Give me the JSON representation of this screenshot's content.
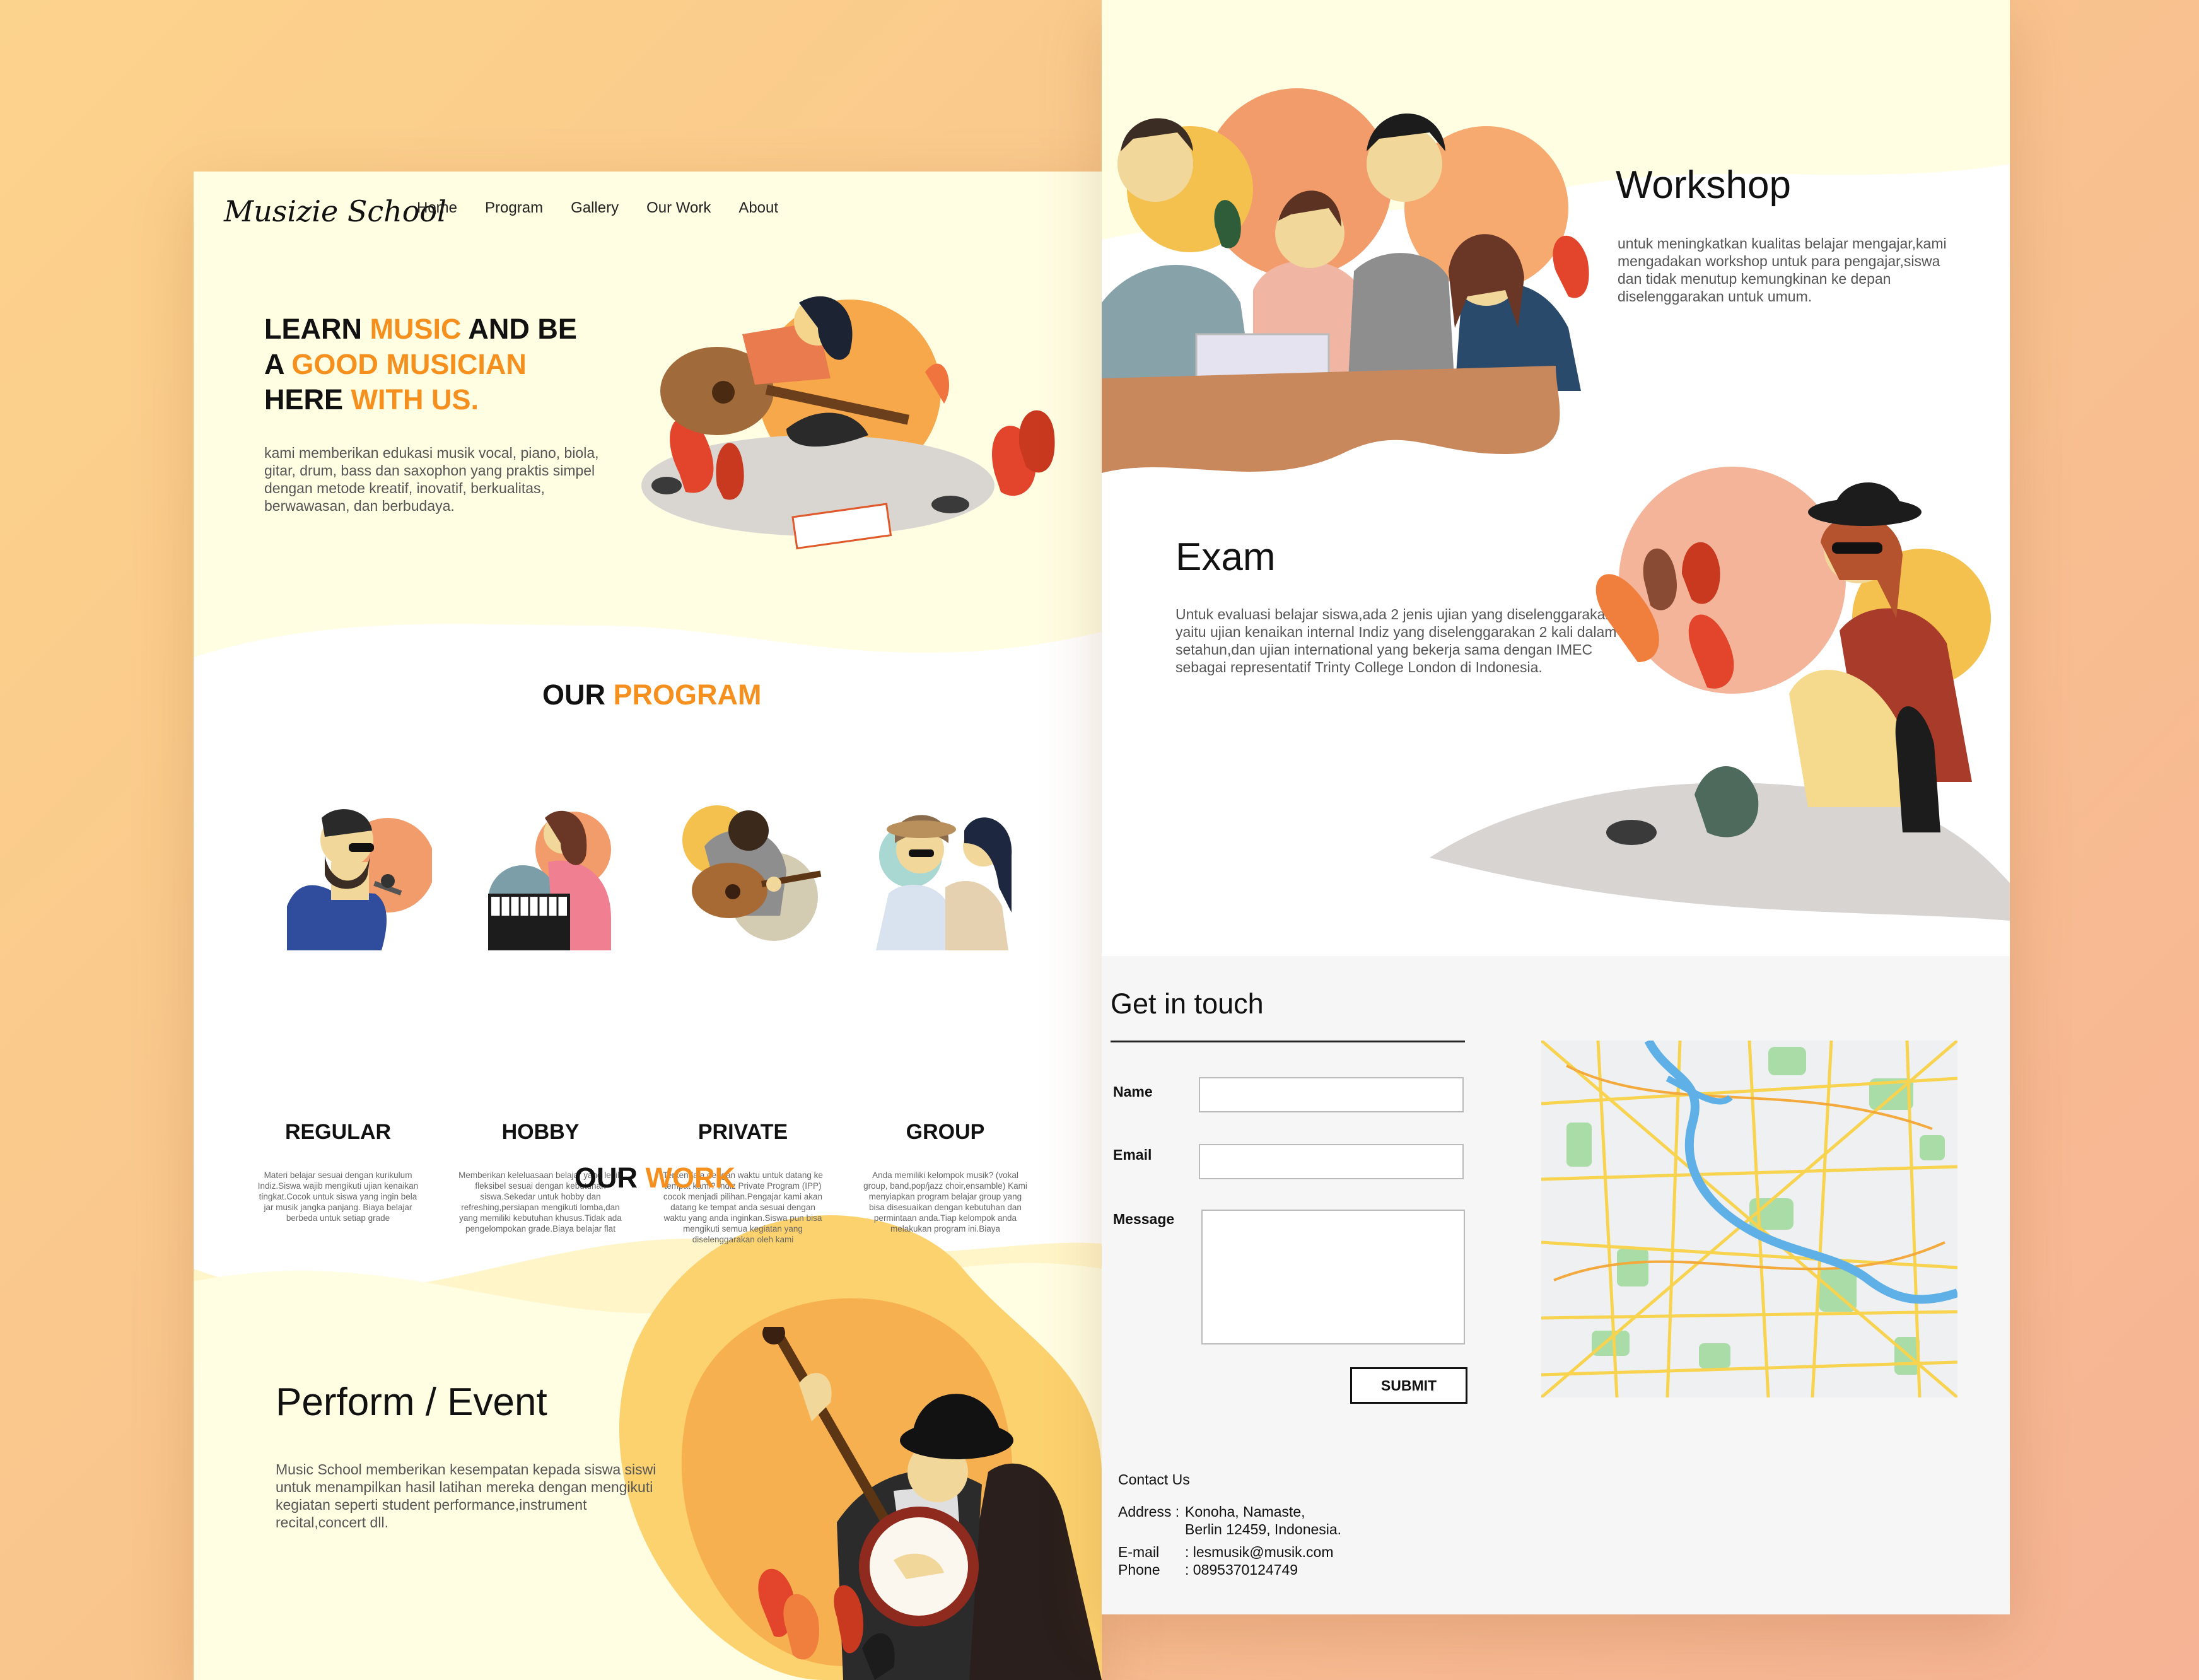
{
  "brand": {
    "logo": "Musizie School"
  },
  "nav": {
    "items": [
      "Home",
      "Program",
      "Gallery",
      "Our Work",
      "About"
    ]
  },
  "hero": {
    "line1_a": "LEARN ",
    "line1_b": "MUSIC",
    "line1_c": " AND BE",
    "line2_a": "A ",
    "line2_b": "GOOD MUSICIAN",
    "line3_a": "HERE ",
    "line3_b": "WITH US.",
    "description": "kami memberikan edukasi musik vocal, piano, biola, gitar, drum, bass dan saxophon yang praktis simpel dengan metode kreatif, inovatif, berkualitas, berwawasan, dan berbudaya."
  },
  "program": {
    "title_a": "OUR ",
    "title_b": "PROGRAM",
    "items": [
      {
        "label": "REGULAR",
        "desc": "Materi belajar sesuai dengan kurikulum Indiz.Siswa wajib mengikuti ujian kenaikan tingkat.Cocok untuk siswa yang ingin bela jar musik jangka panjang. Biaya belajar berbeda untuk setiap grade"
      },
      {
        "label": "HOBBY",
        "desc": "Memberikan keleluasaan belajar yang lebih fleksibel sesuai dengan kebutuhan siswa.Sekedar untuk hobby dan refreshing,persiapan mengikuti lomba,dan yang memiliki kebutuhan khusus.Tidak ada pengelompokan grade.Biaya belajar flat"
      },
      {
        "label": "PRIVATE",
        "desc": "Terkendala dengan waktu untuk datang ke tempat kami? Indiz Private Program (IPP) cocok menjadi pilihan.Pengajar kami akan datang ke tempat anda sesuai dengan waktu yang anda inginkan.Siswa pun bisa mengikuti semua kegiatan yang diselenggarakan oleh kami"
      },
      {
        "label": "GROUP",
        "desc": "Anda memiliki kelompok musik? (vokal group, band,pop/jazz choir,ensamble) Kami menyiapkan program belajar group yang bisa disesuaikan dengan kebutuhan dan permintaan anda.Tiap kelompok anda melakukan program ini.Biaya"
      }
    ]
  },
  "work": {
    "title_a": "OUR ",
    "title_b": "WORK",
    "perform": {
      "title": "Perform / Event",
      "desc": "Music School memberikan kesempatan kepada siswa siswi untuk menampilkan hasil latihan mereka dengan mengikuti kegiatan seperti student performance,instrument recital,concert dll."
    },
    "workshop": {
      "title": "Workshop",
      "desc": "untuk meningkatkan kualitas belajar mengajar,kami mengadakan workshop untuk para pengajar,siswa dan tidak menutup kemungkinan ke depan diselenggarakan untuk umum."
    },
    "exam": {
      "title": "Exam",
      "desc": "Untuk evaluasi belajar siswa,ada 2 jenis ujian yang diselenggarakan yaitu ujian kenaikan internal Indiz yang diselenggarakan 2 kali dalam setahun,dan ujian international yang bekerja sama dengan IMEC sebagai representatif Trinty College London di Indonesia."
    }
  },
  "contact": {
    "title": "Get in touch",
    "name_label": "Name",
    "email_label": "Email",
    "message_label": "Message",
    "submit_label": "SUBMIT",
    "info_title": "Contact Us",
    "address_key": "Address :",
    "address_line1": "Konoha, Namaste,",
    "address_line2": "Berlin 12459, Indonesia.",
    "email_key": "E-mail",
    "email_value": ": lesmusik@musik.com",
    "phone_key": "Phone",
    "phone_value": ": 0895370124749"
  },
  "colors": {
    "accent": "#f5901e",
    "cream": "#fffde2",
    "yellow_wave": "#fdf2a8",
    "coral": "#ef6a3d",
    "map_water": "#5fb0e6",
    "map_road": "#f7d34f",
    "map_park": "#a9dca6"
  }
}
